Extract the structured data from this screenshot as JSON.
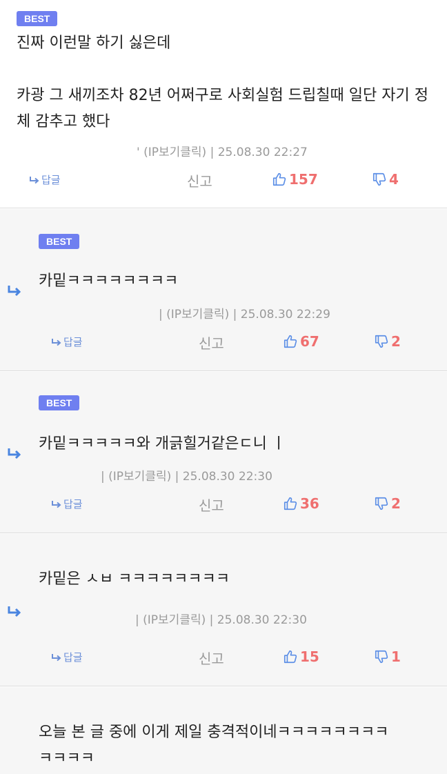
{
  "labels": {
    "badge": "BEST",
    "reply": "답글",
    "report": "신고",
    "ip_hint": "(IP보기클릭)"
  },
  "colors": {
    "badge_bg": "#6f7ff0",
    "reply_arrow": "#4a85e0",
    "reply_link": "#6b8fd8",
    "vote_count": "#ef6f6f",
    "thumb_icon": "#5b8ee6",
    "meta_text": "#9a9a9a"
  },
  "comments": [
    {
      "best": true,
      "text": "진짜 이런말 하기 싫은데\n\n카광 그 새끼조차 82년 어쩌구로 사회실험 드립칠때 일단 자기 정체 감추고 했다",
      "author_prefix": "'",
      "ip": "(IP보기클릭)",
      "date": "25.08.30 22:27",
      "likes": "157",
      "dislikes": "4"
    },
    {
      "best": true,
      "text": "카밑ㅋㅋㅋㅋㅋㅋㅋㅋ",
      "author_prefix": "|",
      "ip": "(IP보기클릭)",
      "date": "25.08.30 22:29",
      "likes": "67",
      "dislikes": "2"
    },
    {
      "best": true,
      "text": "카밑ㅋㅋㅋㅋㅋ와 개긁힐거같은ㄷ니 ㅣ",
      "author_prefix": "|",
      "ip": "(IP보기클릭)",
      "date": "25.08.30 22:30",
      "likes": "36",
      "dislikes": "2"
    },
    {
      "best": false,
      "text": "카밑은 ㅅㅂ ㅋㅋㅋㅋㅋㅋㅋㅋ",
      "author_prefix": "|",
      "ip": "(IP보기클릭)",
      "date": "25.08.30 22:30",
      "likes": "15",
      "dislikes": "1"
    },
    {
      "best": false,
      "text": "오늘 본 글 중에 이게 제일 충격적이네ㅋㅋㅋㅋㅋㅋㅋㅋ\nㅋㅋㅋㅋ"
    }
  ]
}
